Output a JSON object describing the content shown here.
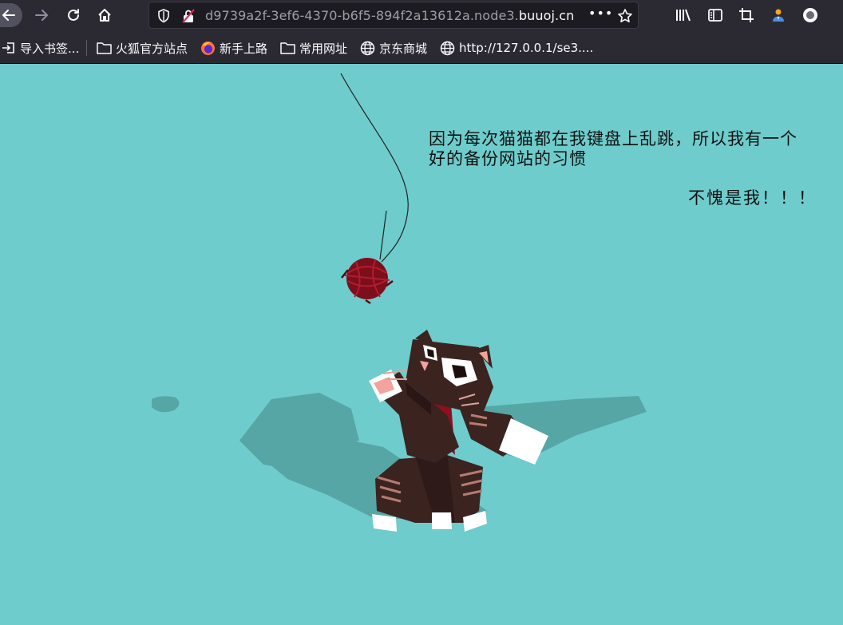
{
  "browser": {
    "url_prefix": "d9739a2f-3ef6-4370-b6f5-894f2a13612a.node3.",
    "url_host": "buuoj.cn",
    "menu_dots": "•••"
  },
  "bookmarks": [
    {
      "label": "导入书签...",
      "icon": "import-icon"
    },
    {
      "label": "火狐官方站点",
      "icon": "folder-icon"
    },
    {
      "label": "新手上路",
      "icon": "firefox-icon"
    },
    {
      "label": "常用网址",
      "icon": "folder-icon"
    },
    {
      "label": "京东商城",
      "icon": "globe-icon"
    },
    {
      "label": "http://127.0.0.1/se3....",
      "icon": "globe-icon"
    }
  ],
  "page": {
    "message": "因为每次猫猫都在我键盘上乱跳，所以我有一个\n好的备份网站的习惯",
    "message2": "不愧是我！！！",
    "background": "#6ecccc"
  }
}
